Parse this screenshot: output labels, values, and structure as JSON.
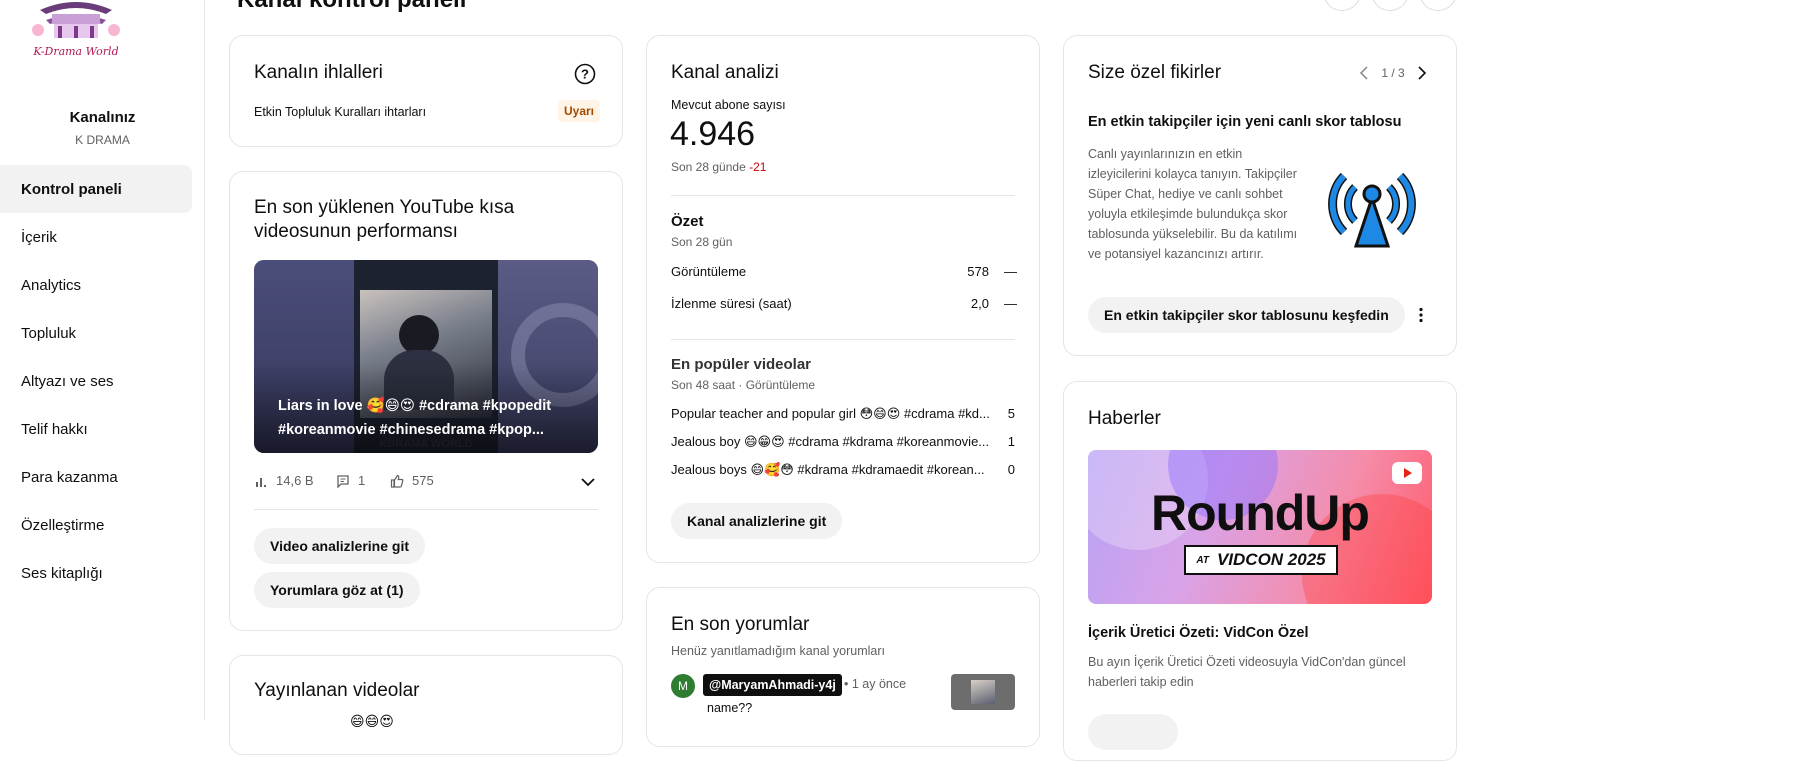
{
  "page_title": "Kanal kontrol paneli",
  "sidebar": {
    "channel_label": "Kanalınız",
    "channel_name": "K DRAMA",
    "logo_text": "K-Drama World",
    "items": [
      {
        "label": "Kontrol paneli",
        "active": true
      },
      {
        "label": "İçerik"
      },
      {
        "label": "Analytics"
      },
      {
        "label": "Topluluk"
      },
      {
        "label": "Altyazı ve ses"
      },
      {
        "label": "Telif hakkı"
      },
      {
        "label": "Para kazanma"
      },
      {
        "label": "Özelleştirme"
      },
      {
        "label": "Ses kitaplığı"
      }
    ]
  },
  "violations": {
    "title": "Kanalın ihlalleri",
    "row_label": "Etkin Topluluk Kuralları ihtarları",
    "badge": "Uyarı"
  },
  "short_perf": {
    "title": "En son yüklenen YouTube kısa videosunun performansı",
    "video_caption": "Liars in love 🥰😄😍 #cdrama #kpopedit #koreanmovie #chinesedrama #kpop...",
    "thumb_watermark": "KDRAMA WORLD",
    "views": "14,6 B",
    "comments": "1",
    "likes": "575",
    "btn_analytics": "Video analizlerine git",
    "btn_comments": "Yorumlara göz at (1)"
  },
  "published": {
    "title": "Yayınlanan videolar"
  },
  "analytics": {
    "title": "Kanal analizi",
    "subs_label": "Mevcut abone sayısı",
    "subs_value": "4.946",
    "subs_period": "Son 28 günde",
    "subs_change": "-21",
    "summary_title": "Özet",
    "summary_period": "Son 28 gün",
    "metrics": [
      {
        "label": "Görüntüleme",
        "value": "578",
        "trend": "—"
      },
      {
        "label": "İzlenme süresi (saat)",
        "value": "2,0",
        "trend": "—"
      }
    ],
    "top_title": "En popüler videolar",
    "top_period": "Son 48 saat · Görüntüleme",
    "top_videos": [
      {
        "title": "Popular teacher and popular girl 😳😄😍 #cdrama #kd...",
        "views": "5"
      },
      {
        "title": "Jealous boy 😄😁😍 #cdrama #kdrama #koreanmovie...",
        "views": "1"
      },
      {
        "title": "Jealous boys 😄🥰😳 #kdrama #kdramaedit #korean...",
        "views": "0"
      }
    ],
    "btn": "Kanal analizlerine git"
  },
  "comments": {
    "title": "En son yorumlar",
    "subtitle": "Henüz yanıtlamadığım kanal yorumları",
    "items": [
      {
        "avatar_letter": "M",
        "author": "@MaryamAhmadi-y4j",
        "time": "• 1 ay önce",
        "text": "name??"
      }
    ]
  },
  "ideas": {
    "title": "Size özel fikirler",
    "pager": "1 / 3",
    "headline": "En etkin takipçiler için yeni canlı skor tablosu",
    "body": "Canlı yayınlarınızın en etkin izleyicilerini kolayca tanıyın. Takipçiler Süper Chat, hediye ve canlı sohbet yoluyla etkileşimde bulundukça skor tablosunda yükselebilir. Bu da katılımı ve potansiyel kazancınızı artırır.",
    "btn": "En etkin takipçiler skor tablosunu keşfedin"
  },
  "news": {
    "title": "Haberler",
    "banner_main": "RoundUp",
    "banner_at": "AT",
    "banner_event": "VIDCON 2025",
    "headline": "İçerik Üretici Özeti: VidCon Özel",
    "body": "Bu ayın İçerik Üretici Özeti videosuyla VidCon'dan güncel haberleri takip edin"
  },
  "colors": {
    "accent_red": "#cc0000",
    "warn_bg": "#fff4e5",
    "warn_text": "#a34a00",
    "avatar_green": "#2e7d32",
    "icon_blue": "#1565c0"
  }
}
